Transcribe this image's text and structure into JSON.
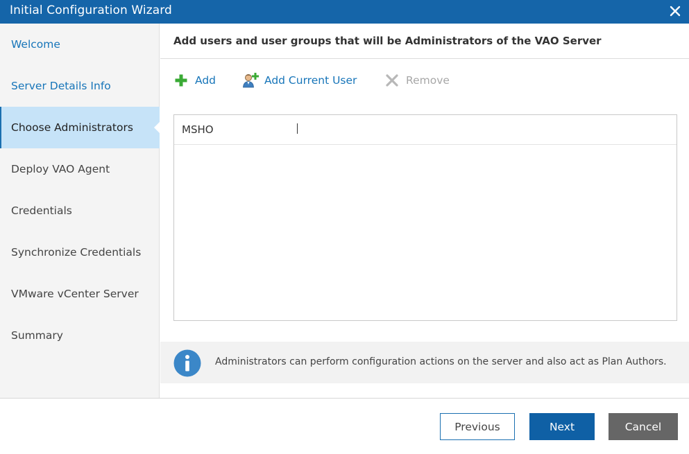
{
  "window": {
    "title": "Initial Configuration Wizard",
    "close_icon": "close-icon"
  },
  "sidebar": {
    "items": [
      {
        "label": "Welcome",
        "state": "done"
      },
      {
        "label": "Server Details Info",
        "state": "done"
      },
      {
        "label": "Choose Administrators",
        "state": "active"
      },
      {
        "label": "Deploy VAO Agent",
        "state": "pending"
      },
      {
        "label": "Credentials",
        "state": "pending"
      },
      {
        "label": "Synchronize Credentials",
        "state": "pending"
      },
      {
        "label": "VMware vCenter Server",
        "state": "pending"
      },
      {
        "label": "Summary",
        "state": "pending"
      }
    ]
  },
  "main": {
    "heading": "Add users and user groups that will be Administrators of the VAO Server",
    "toolbar": {
      "add_label": "Add",
      "add_icon": "plus-icon",
      "add_current_user_label": "Add Current User",
      "add_current_user_icon": "add-user-icon",
      "remove_label": "Remove",
      "remove_icon": "x-icon"
    },
    "admins": [
      {
        "name": "MSHO"
      }
    ],
    "info": {
      "icon": "info-icon",
      "text": "Administrators can perform configuration actions on the server and also act as Plan Authors."
    }
  },
  "footer": {
    "previous_label": "Previous",
    "next_label": "Next",
    "cancel_label": "Cancel"
  },
  "colors": {
    "titlebar": "#1565a9",
    "link": "#1775b9",
    "active_nav_bg": "#c6e3f8",
    "primary_button": "#0f60a5",
    "cancel_button": "#666666",
    "add_icon_green": "#3aaa35",
    "info_icon_blue": "#3b87c8"
  }
}
